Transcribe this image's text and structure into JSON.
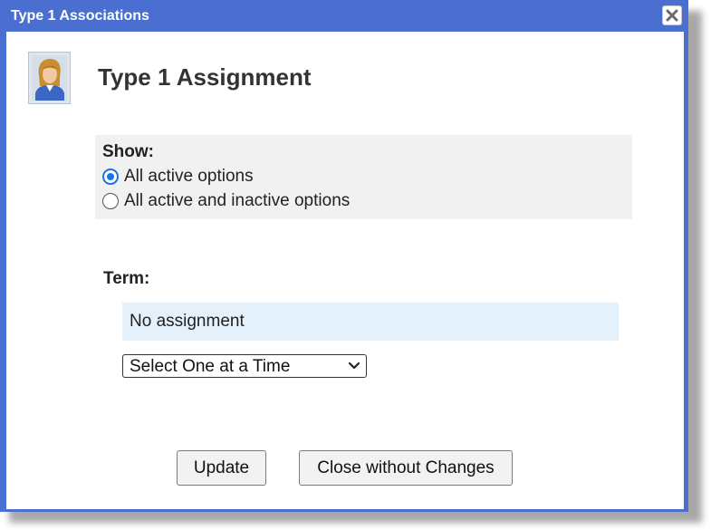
{
  "window": {
    "title": "Type 1 Associations"
  },
  "header": {
    "title": "Type 1 Assignment"
  },
  "show": {
    "label": "Show:",
    "options": [
      {
        "label": "All active options",
        "checked": true
      },
      {
        "label": "All active and inactive options",
        "checked": false
      }
    ]
  },
  "term": {
    "label": "Term:",
    "current_assignment": "No assignment",
    "select_value": "Select One at a Time"
  },
  "buttons": {
    "update": "Update",
    "close_without_changes": "Close without Changes"
  },
  "colors": {
    "titlebar": "#4a6fd0",
    "panel": "#f1f1f1",
    "assignment_bg": "#e4f1fb",
    "radio_accent": "#1a73e8"
  },
  "icons": {
    "close": "close-icon",
    "avatar": "user-avatar-icon",
    "select_arrow": "chevron-down-icon"
  }
}
